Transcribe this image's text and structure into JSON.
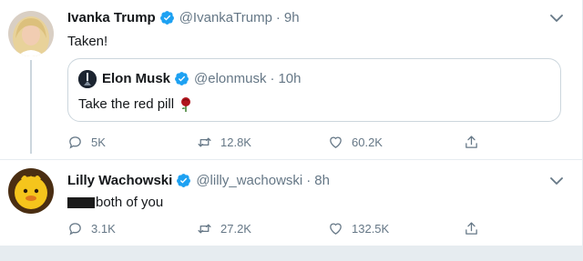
{
  "tweets": [
    {
      "author_name": "Ivanka Trump",
      "handle": "@IvankaTrump",
      "dot": "·",
      "time": "9h",
      "text": "Taken!",
      "quote": {
        "author_name": "Elon Musk",
        "handle": "@elonmusk",
        "dot": "·",
        "time": "10h",
        "text": "Take the red pill"
      },
      "replies": "5K",
      "retweets": "12.8K",
      "likes": "60.2K"
    },
    {
      "author_name": "Lilly Wachowski",
      "handle": "@lilly_wachowski",
      "dot": "·",
      "time": "8h",
      "text": "both of you",
      "replies": "3.1K",
      "retweets": "27.2K",
      "likes": "132.5K"
    }
  ],
  "colors": {
    "verified": "#1da1f2",
    "secondary_text": "#657786",
    "border": "#ccd6dd",
    "rose": "#b0151d"
  },
  "icons": [
    "verified-badge-icon",
    "chevron-down-icon",
    "reply-icon",
    "retweet-icon",
    "like-icon",
    "share-icon",
    "rose-emoji-icon"
  ]
}
